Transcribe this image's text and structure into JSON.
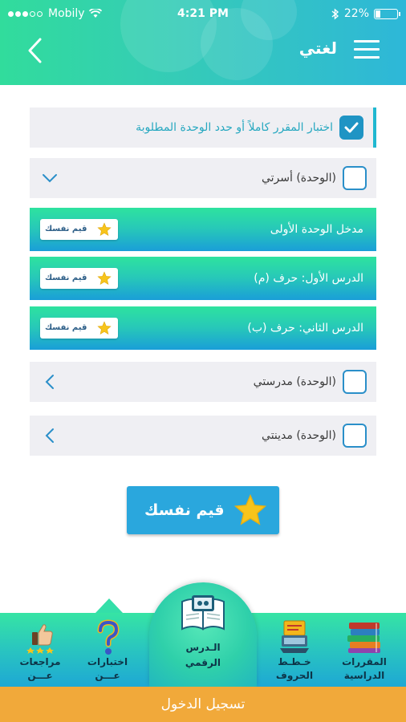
{
  "status_bar": {
    "carrier": "Mobily",
    "time": "4:21 PM",
    "battery": "22%",
    "battery_level": 0.22
  },
  "header": {
    "title": "لغتي"
  },
  "rows": [
    {
      "label": "اختبار المقرر كاملاً أو حدد الوحدة المطلوبة",
      "checked": true
    },
    {
      "label": "(الوحدة) أسرتي",
      "checked": false,
      "icon": "chevron-down-icon"
    },
    {
      "label": "مدخل الوحدة الأولى",
      "button": "قيم نفسك"
    },
    {
      "label": "الدرس الأول: حرف (م)",
      "button": "قيم نفسك"
    },
    {
      "label": "الدرس الثاني: حرف (ب)",
      "button": "قيم نفسك"
    },
    {
      "label": "(الوحدة) مدرستي",
      "checked": false,
      "icon": "chevron-left-icon"
    },
    {
      "label": "(الوحدة) مدينتي",
      "checked": false,
      "icon": "chevron-left-icon"
    }
  ],
  "evaluate_button": {
    "label": "قيم نفسك"
  },
  "tabs": {
    "reviews": {
      "line1": "مراجعات",
      "line2": "عـــن"
    },
    "tests": {
      "line1": "اختبارات",
      "line2": "عـــن"
    },
    "digital_lesson": {
      "line1": "الـدرس",
      "line2": "الرقمي"
    },
    "letter_plans": {
      "line1": "خـطـط",
      "line2": "الحروف"
    },
    "courses": {
      "line1": "المقررات",
      "line2": "الدراسية"
    }
  },
  "bottom_bar": {
    "label": "تسجيل الدخول"
  },
  "colors": {
    "brand_green": "#31dc9c",
    "brand_blue": "#2aa7dd",
    "login_orange": "#f1a93a",
    "star": "#f7c41b"
  }
}
